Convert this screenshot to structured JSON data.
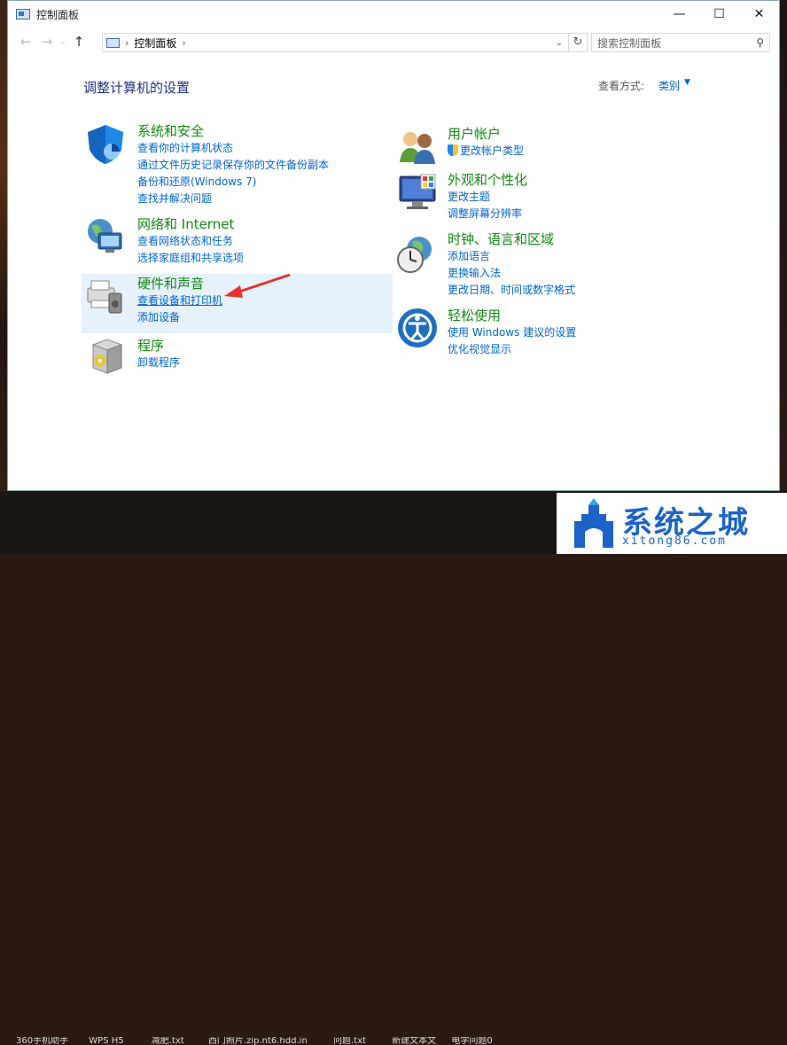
{
  "window": {
    "title": "控制面板"
  },
  "address": {
    "crumb": "控制面板",
    "separator": "›"
  },
  "search": {
    "placeholder": "搜索控制面板"
  },
  "page": {
    "title": "调整计算机的设置",
    "view_by_label": "查看方式:",
    "view_by_value": "类别"
  },
  "categories": [
    {
      "title": "系统和安全",
      "links": [
        "查看你的计算机状态",
        "通过文件历史记录保存你的文件备份副本",
        "备份和还原(Windows 7)",
        "查找并解决问题"
      ]
    },
    {
      "title": "网络和 Internet",
      "links": [
        "查看网络状态和任务",
        "选择家庭组和共享选项"
      ]
    },
    {
      "title": "硬件和声音",
      "links": [
        "查看设备和打印机",
        "添加设备"
      ]
    },
    {
      "title": "程序",
      "links": [
        "卸载程序"
      ]
    },
    {
      "title": "用户帐户",
      "links": [
        "更改帐户类型"
      ]
    },
    {
      "title": "外观和个性化",
      "links": [
        "更改主题",
        "调整屏幕分辨率"
      ]
    },
    {
      "title": "时钟、语言和区域",
      "links": [
        "添加语言",
        "更换输入法",
        "更改日期、时间或数字格式"
      ]
    },
    {
      "title": "轻松使用",
      "links": [
        "使用 Windows 建议的设置",
        "优化视觉显示"
      ]
    }
  ],
  "taskbar": {
    "items": [
      "360手机助手",
      "WPS H5",
      "减肥.txt",
      "西门照片.zip.nt6.hdd.in",
      "问题.txt",
      "新建文本文",
      "电学问题0"
    ]
  },
  "watermark": {
    "main": "系统之城",
    "sub": "xitong86.com"
  },
  "colors": {
    "link": "#0066cc",
    "category_title": "#128a12",
    "page_title": "#1e3287",
    "highlight": "#e5f1fb",
    "annotation_arrow": "#e8312f"
  }
}
